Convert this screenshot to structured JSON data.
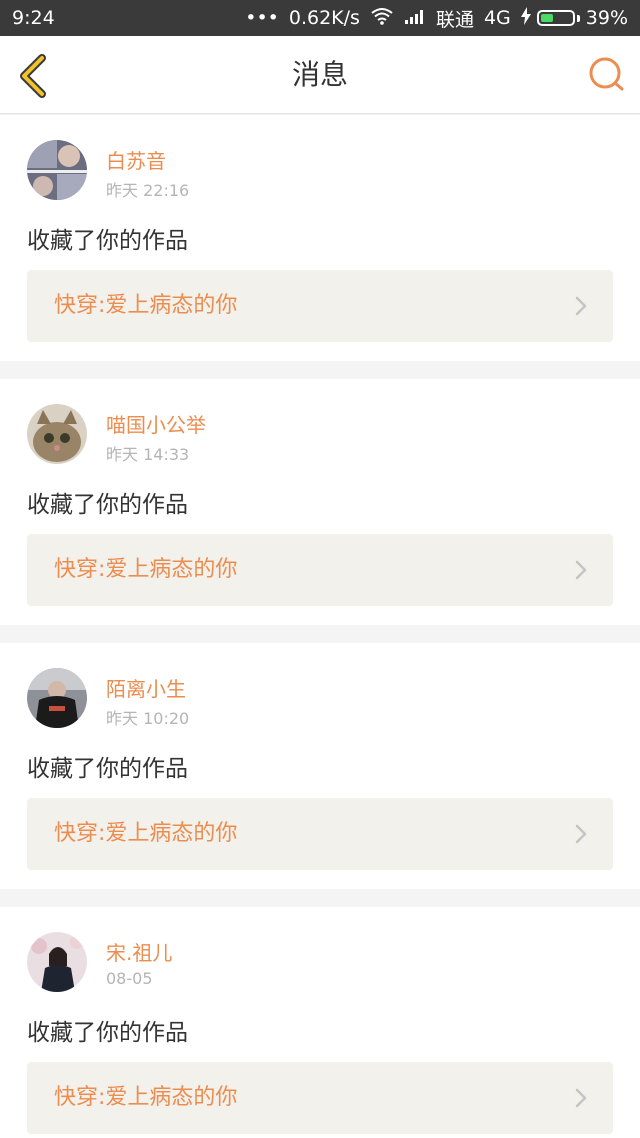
{
  "status": {
    "time": "9:24",
    "dots": "•••",
    "speed": "0.62K/s",
    "carrier": "联通",
    "network": "4G",
    "battery": "39%",
    "battery_level": 0.39
  },
  "header": {
    "title": "消息",
    "back_icon": "chevron-left-icon",
    "search_icon": "search-icon"
  },
  "colors": {
    "accent": "#ec8d4f",
    "back": "#f2c22a",
    "status_bg": "#3a3a3a"
  },
  "messages": [
    {
      "name": "白苏音",
      "time": "昨天 22:16",
      "action": "收藏了你的作品",
      "work": "快穿:爱上病态的你"
    },
    {
      "name": "喵国小公举",
      "time": "昨天 14:33",
      "action": "收藏了你的作品",
      "work": "快穿:爱上病态的你"
    },
    {
      "name": "陌离小生",
      "time": "昨天 10:20",
      "action": "收藏了你的作品",
      "work": "快穿:爱上病态的你"
    },
    {
      "name": "宋.祖儿",
      "time": "08-05",
      "action": "收藏了你的作品",
      "work": "快穿:爱上病态的你"
    }
  ]
}
